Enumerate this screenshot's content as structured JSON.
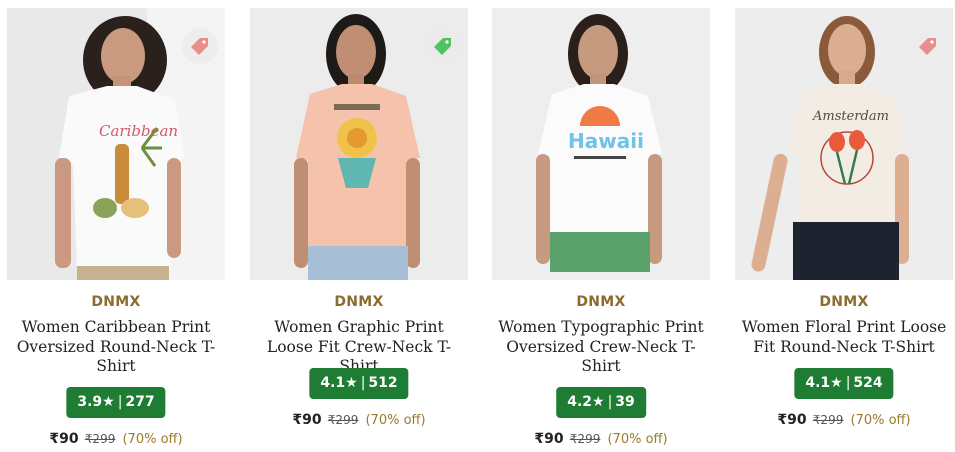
{
  "products": [
    {
      "brand": "DNMX",
      "name": "Women Caribbean Print Oversized Round-Neck T-Shirt",
      "rating": "3.9",
      "star": "★",
      "reviews": "277",
      "price": "₹90",
      "mrp": "₹299",
      "discount": "(70% off)",
      "tag_color": "#e88f8c",
      "image_icon": "woman-white-caribbean-tshirt-image"
    },
    {
      "brand": "DNMX",
      "name": "Women Graphic Print Loose Fit Crew-Neck T-Shirt",
      "rating": "4.1",
      "star": "★",
      "reviews": "512",
      "price": "₹90",
      "mrp": "₹299",
      "discount": "(70% off)",
      "tag_color": "#4fc35f",
      "image_icon": "woman-peach-graphic-tshirt-image"
    },
    {
      "brand": "DNMX",
      "name": "Women Typographic Print Oversized Crew-Neck T-Shirt",
      "rating": "4.2",
      "star": "★",
      "reviews": "39",
      "price": "₹90",
      "mrp": "₹299",
      "discount": "(70% off)",
      "tag_color": null,
      "image_icon": "woman-white-hawaii-tshirt-image"
    },
    {
      "brand": "DNMX",
      "name": "Women Floral Print Loose Fit Round-Neck T-Shirt",
      "rating": "4.1",
      "star": "★",
      "reviews": "524",
      "price": "₹90",
      "mrp": "₹299",
      "discount": "(70% off)",
      "tag_color": "#e88f8c",
      "image_icon": "woman-floral-amsterdam-tshirt-image"
    }
  ],
  "colors": {
    "brand": "#8b6b2e",
    "rating_bg": "#1e7d32",
    "discount": "#9a7a2b"
  }
}
